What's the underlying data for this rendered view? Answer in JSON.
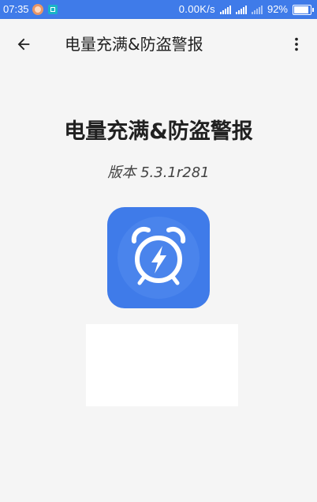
{
  "status_bar": {
    "time": "07:35",
    "net_speed": "0.00K/s",
    "battery_percent": "92%",
    "battery_level": 0.92,
    "icons": [
      "avatar-icon",
      "scan-icon",
      "signal-4g-icon",
      "signal-4g-icon",
      "signal-weak-icon",
      "battery-icon"
    ]
  },
  "app_bar": {
    "title": "电量充满&防盗警报",
    "back_icon": "arrow-left-icon",
    "overflow_icon": "more-vert-icon"
  },
  "about": {
    "title": "电量充满&防盗警报",
    "version_label": "版本",
    "version_value": "5.3.1r281",
    "app_icon": "alarm-clock-lightning-icon",
    "colors": {
      "accent": "#3f7be9",
      "icon_inner": "#4a84ec"
    }
  }
}
